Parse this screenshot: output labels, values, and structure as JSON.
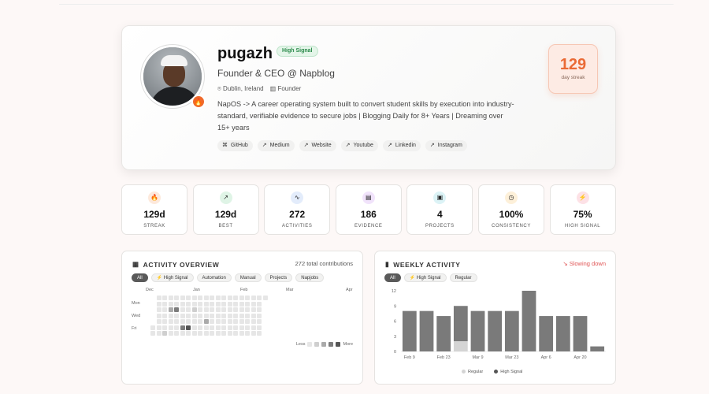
{
  "profile": {
    "name": "pugazh",
    "badge": "High Signal",
    "role": "Founder & CEO @ Napblog",
    "location": "Dublin, Ireland",
    "org_type": "Founder",
    "bio": "NapOS -> A career operating system built to convert student skills by execution into industry-standard, verifiable evidence to secure jobs | Blogging Daily for 8+ Years | Dreaming over 15+ years",
    "links": [
      "GitHub",
      "Medium",
      "Website",
      "Youtube",
      "Linkedin",
      "Instagram"
    ],
    "streak_value": "129",
    "streak_label": "day streak"
  },
  "stats": [
    {
      "icon": "flame-icon",
      "glyph": "🔥",
      "value": "129d",
      "label": "STREAK",
      "color": "#fde9dc"
    },
    {
      "icon": "trend-up-icon",
      "glyph": "↗",
      "value": "129d",
      "label": "BEST",
      "color": "#dff4e6"
    },
    {
      "icon": "activity-icon",
      "glyph": "∿",
      "value": "272",
      "label": "ACTIVITIES",
      "color": "#e3ecfb"
    },
    {
      "icon": "document-icon",
      "glyph": "▤",
      "value": "186",
      "label": "EVIDENCE",
      "color": "#f1e3fb"
    },
    {
      "icon": "briefcase-icon",
      "glyph": "▣",
      "value": "4",
      "label": "PROJECTS",
      "color": "#dcf3f6"
    },
    {
      "icon": "clock-icon",
      "glyph": "◷",
      "value": "100%",
      "label": "CONSISTENCY",
      "color": "#fdf0d9"
    },
    {
      "icon": "bolt-icon",
      "glyph": "⚡",
      "value": "75%",
      "label": "HIGH SIGNAL",
      "color": "#fde1e6"
    }
  ],
  "activity": {
    "title": "ACTIVITY OVERVIEW",
    "total": "272 total contributions",
    "chips": [
      "All",
      "⚡ High Signal",
      "Automation",
      "Manual",
      "Projects",
      "Napjobs"
    ],
    "months": [
      "Dec",
      "Jan",
      "Feb",
      "Mar",
      "Apr"
    ],
    "days": [
      "Mon",
      "Wed",
      "Fri"
    ],
    "legend_less": "Less",
    "legend_more": "More",
    "levels": [
      "#e6e6e6",
      "#cfcfcf",
      "#aaaaaa",
      "#7c7c7c",
      "#555555"
    ]
  },
  "weekly": {
    "title": "WEEKLY ACTIVITY",
    "trend": "↘ Slowing down",
    "chips": [
      "All",
      "⚡ High Signal",
      "Regular"
    ],
    "legend_regular": "Regular",
    "legend_high": "High Signal"
  },
  "chart_data": {
    "type": "bar",
    "categories": [
      "Feb 9",
      "Feb 16",
      "Feb 23",
      "Mar 2",
      "Mar 9",
      "Mar 16",
      "Mar 23",
      "Mar 30",
      "Apr 6",
      "Apr 13",
      "Apr 20",
      "Apr 27"
    ],
    "tick_labels": [
      "Feb 9",
      "Feb 23",
      "Mar 9",
      "Mar 23",
      "Apr 6",
      "Apr 20"
    ],
    "series": [
      {
        "name": "High Signal",
        "values": [
          8,
          8,
          7,
          7,
          8,
          8,
          8,
          12,
          7,
          7,
          7,
          1
        ],
        "color": "#7a7a7a"
      },
      {
        "name": "Regular",
        "values": [
          0,
          0,
          0,
          2,
          0,
          0,
          0,
          0,
          0,
          0,
          0,
          0
        ],
        "color": "#d4d4d4"
      }
    ],
    "yticks": [
      0,
      3,
      6,
      9,
      12
    ],
    "ylim": [
      0,
      12
    ]
  }
}
